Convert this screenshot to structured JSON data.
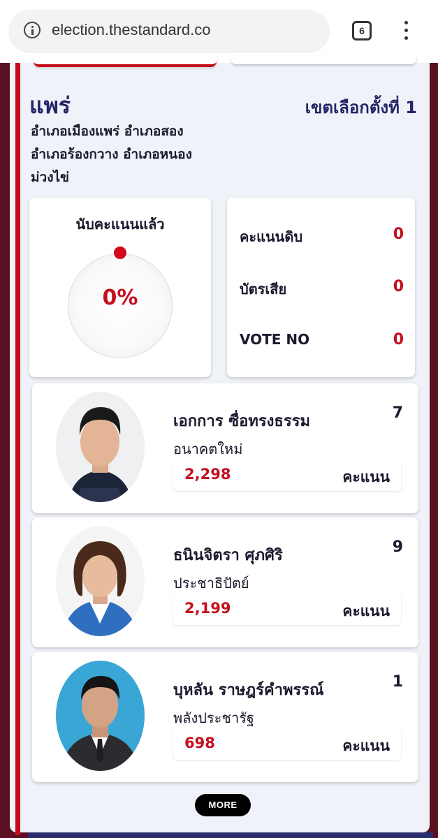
{
  "browser": {
    "url": "election.thestandard.co",
    "tab_count": "6"
  },
  "header": {
    "province": "แพร่",
    "district": "เขตเลือกตั้งที่ 1",
    "amphoe_lines": [
      "อำเภอเมืองแพร่ อำเภอสอง",
      "อำเภอร้องกวาง อำเภอหนอง",
      "ม่วงไข่"
    ]
  },
  "count": {
    "label": "นับคะแนนแล้ว",
    "percent": "0%",
    "progress_fraction": 0
  },
  "stats": [
    {
      "label": "คะแนนดิบ",
      "value": "0"
    },
    {
      "label": "บัตรเสีย",
      "value": "0"
    },
    {
      "label": "VOTE NO",
      "value": "0"
    }
  ],
  "candidates": [
    {
      "name": "เอกการ ซื่อทรงธรรม",
      "party": "อนาคตใหม่",
      "number": "7",
      "score": "2,298",
      "unit": "คะแนน"
    },
    {
      "name": "ธนินจิตรา ศุภศิริ",
      "party": "ประชาธิปัตย์",
      "number": "9",
      "score": "2,199",
      "unit": "คะแนน"
    },
    {
      "name": "บุหลัน ราษฎร์คำพรรณ์",
      "party": "พลังประชารัฐ",
      "number": "1",
      "score": "698",
      "unit": "คะแนน"
    }
  ],
  "more_label": "MORE",
  "colors": {
    "accent_red": "#c4101e",
    "navy": "#232566",
    "panel": "#f0f2f9",
    "background": "#6b0f24"
  }
}
